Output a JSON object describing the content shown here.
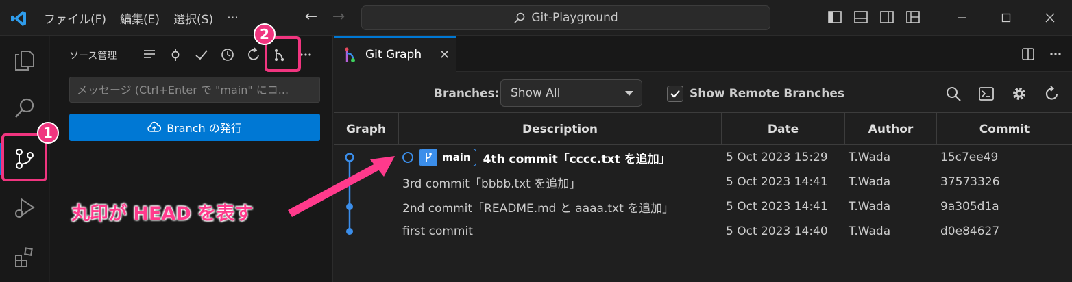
{
  "titlebar": {
    "menu": [
      "ファイル(F)",
      "編集(E)",
      "選択(S)",
      "⋯"
    ],
    "search": "Git-Playground"
  },
  "sidebar": {
    "title": "ソース管理",
    "message_placeholder": "メッセージ (Ctrl+Enter で \"main\" にコ...",
    "publish_label": "Branch の発行"
  },
  "editor": {
    "tab_label": "Git Graph",
    "tab_close": "✕",
    "branches_label": "Branches:",
    "branch_select_value": "Show All",
    "show_remote_label": "Show Remote Branches",
    "show_remote_checked": true,
    "columns": [
      "Graph",
      "Description",
      "Date",
      "Author",
      "Commit"
    ],
    "head_branch": "main",
    "commits": [
      {
        "description": "4th commit「cccc.txt を追加」",
        "date": "5 Oct 2023 15:29",
        "author": "T.Wada",
        "commit": "15c7ee49",
        "head": true
      },
      {
        "description": "3rd commit「bbbb.txt を追加」",
        "date": "5 Oct 2023 14:41",
        "author": "T.Wada",
        "commit": "37573326",
        "head": false
      },
      {
        "description": "2nd commit「README.md と aaaa.txt を追加」",
        "date": "5 Oct 2023 14:41",
        "author": "T.Wada",
        "commit": "9a305d1a",
        "head": false
      },
      {
        "description": "first commit",
        "date": "5 Oct 2023 14:40",
        "author": "T.Wada",
        "commit": "d0e84627",
        "head": false
      }
    ]
  },
  "annotations": {
    "badge1": "1",
    "badge2": "2",
    "callout": "丸印が HEAD を表す"
  },
  "colors": {
    "accent": "#0078d4",
    "graph_blue": "#3b8eea",
    "annotation": "#f0357f"
  }
}
